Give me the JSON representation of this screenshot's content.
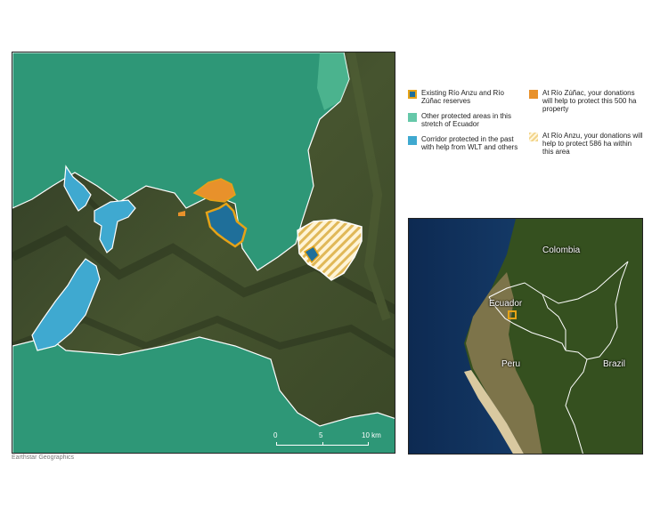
{
  "legend": {
    "existing": "Existing Río Anzu and Río Zúñac reserves",
    "other": "Other protected areas in this stretch of Ecuador",
    "corridor": "Corridor protected in the past with help from WLT and others",
    "zunac": "At Río Zúñac, your donations will help to protect this 500 ha property",
    "anzu": "At Río Anzu, your donations will help to protect 586 ha within this area"
  },
  "scale": {
    "zero": "0",
    "mid": "5",
    "end": "10 km"
  },
  "attribution": "Earthstar Geographics",
  "inset": {
    "colombia": "Colombia",
    "ecuador": "Ecuador",
    "peru": "Peru",
    "brazil": "Brazil"
  },
  "colors": {
    "protected": "#2f9a7a",
    "corridor": "#3fa9d0",
    "existing_outline": "#e6a317",
    "zunac": "#e8912b",
    "anzu_hatch": "#f2d48a"
  }
}
